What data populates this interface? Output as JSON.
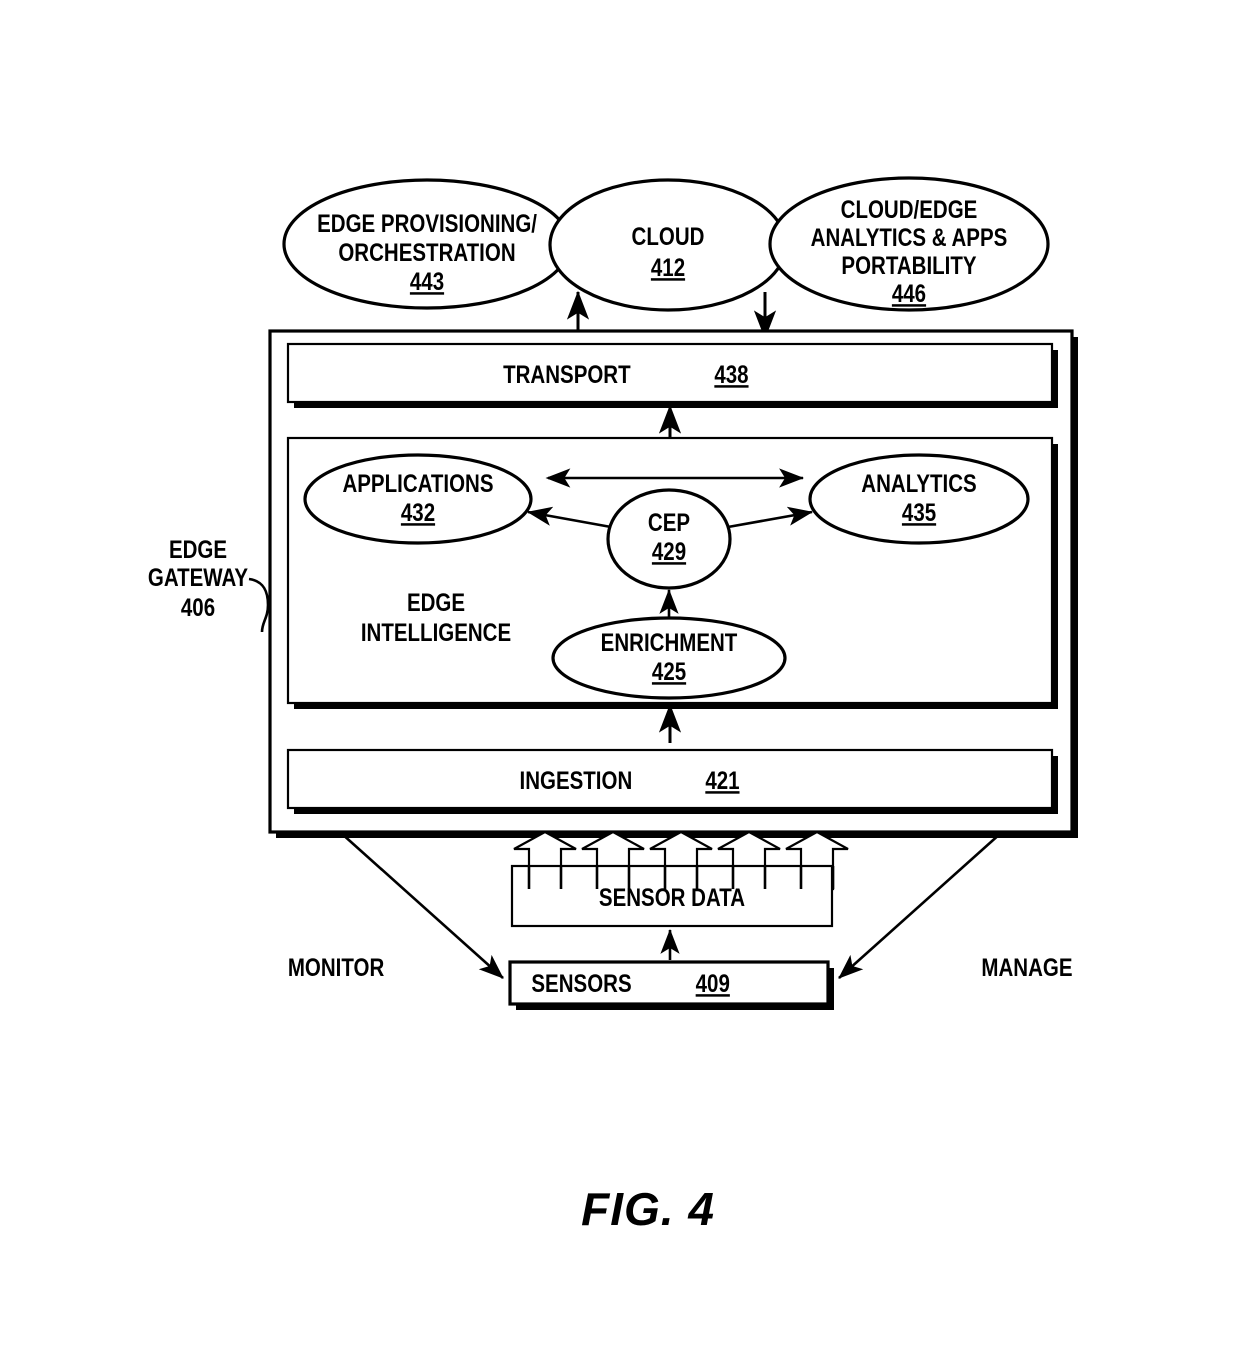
{
  "figure": {
    "caption": "FIG. 4",
    "number": "4"
  },
  "cloud_layer": {
    "nodes": [
      {
        "id": "edge-provisioning-orchestration",
        "lines": [
          "EDGE PROVISIONING/",
          "ORCHESTRATION"
        ],
        "ref": "443"
      },
      {
        "id": "cloud",
        "lines": [
          "CLOUD"
        ],
        "ref": "412"
      },
      {
        "id": "cloud-edge-analytics-apps-portability",
        "lines": [
          "CLOUD/EDGE",
          "ANALYTICS & APPS",
          "PORTABILITY"
        ],
        "ref": "446"
      }
    ]
  },
  "gateway": {
    "label_lines": [
      "EDGE",
      "GATEWAY"
    ],
    "ref": "406",
    "transport": {
      "label": "TRANSPORT",
      "ref": "438"
    },
    "ingestion": {
      "label": "INGESTION",
      "ref": "421"
    },
    "edge_intelligence": {
      "title_lines": [
        "EDGE",
        "INTELLIGENCE"
      ],
      "nodes": [
        {
          "id": "applications",
          "label": "APPLICATIONS",
          "ref": "432"
        },
        {
          "id": "cep",
          "label": "CEP",
          "ref": "429"
        },
        {
          "id": "analytics",
          "label": "ANALYTICS",
          "ref": "435"
        },
        {
          "id": "enrichment",
          "label": "ENRICHMENT",
          "ref": "425"
        }
      ]
    }
  },
  "sensor_layer": {
    "sensor_data": {
      "label": "SENSOR DATA",
      "arrow_count": 5
    },
    "sensors": {
      "label": "SENSORS",
      "ref": "409"
    },
    "left_annotation": "MONITOR",
    "right_annotation": "MANAGE"
  },
  "colors": {
    "stroke": "#000000",
    "fill": "#ffffff",
    "background": "#ffffff"
  }
}
